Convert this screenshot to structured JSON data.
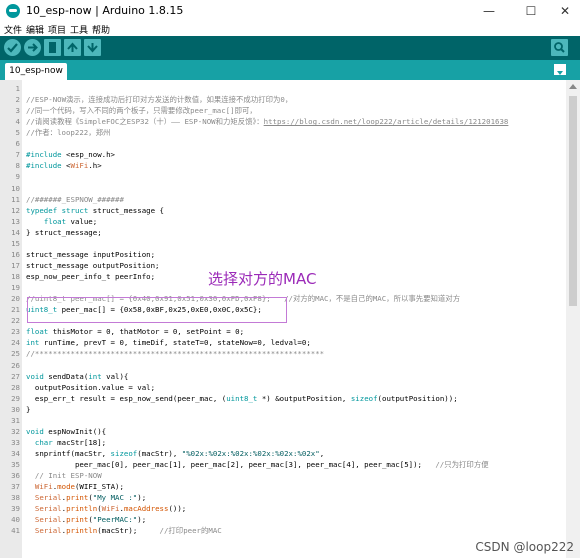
{
  "window": {
    "title": "10_esp-now | Arduino 1.8.15",
    "controls": [
      "—",
      "☐",
      "✕"
    ]
  },
  "menu": [
    "文件",
    "编辑",
    "项目",
    "工具",
    "帮助"
  ],
  "toolbar_icons": [
    "verify-icon",
    "upload-icon",
    "new-icon",
    "open-icon",
    "save-icon",
    "serial-monitor-icon"
  ],
  "tab": {
    "label": "10_esp-now"
  },
  "annotation": {
    "label": "选择对方的MAC"
  },
  "watermark": "CSDN @loop222",
  "code_lines": [
    {
      "n": "1",
      "html": ""
    },
    {
      "n": "2",
      "html": "<span class=\"cmt\">//ESP-NOW演示，连接成功后打印对方发送的计数值，如果连接不成功打印为0，</span>"
    },
    {
      "n": "3",
      "html": "<span class=\"cmt\">//同一个代码，写入不同的两个板子，只需要修改peer_mac[]即可，</span>"
    },
    {
      "n": "4",
      "html": "<span class=\"cmt\">//请阅读教程《SimpleFOC之ESP32（十）—— ESP-NOW和力矩反馈》：<u>https://blog.csdn.net/loop222/article/details/121201638</u></span>"
    },
    {
      "n": "5",
      "html": "<span class=\"cmt\">//作者：loop222，郑州</span>"
    },
    {
      "n": "6",
      "html": ""
    },
    {
      "n": "7",
      "html": "<span class=\"kw\">#include</span> &lt;esp_now.h&gt;"
    },
    {
      "n": "8",
      "html": "<span class=\"kw\">#include</span> &lt;<span class=\"type\">WiFi</span>.h&gt;"
    },
    {
      "n": "9",
      "html": ""
    },
    {
      "n": "10",
      "html": ""
    },
    {
      "n": "11",
      "html": "<span class=\"cmt\">//######_ESPNOW_######</span>"
    },
    {
      "n": "12",
      "html": "<span class=\"kw\">typedef</span> <span class=\"kw\">struct</span> struct_message {"
    },
    {
      "n": "13",
      "html": "    <span class=\"kw\">float</span> value;"
    },
    {
      "n": "14",
      "html": "} struct_message;"
    },
    {
      "n": "15",
      "html": ""
    },
    {
      "n": "16",
      "html": "struct_message inputPosition;"
    },
    {
      "n": "17",
      "html": "struct_message outputPosition;"
    },
    {
      "n": "18",
      "html": "esp_now_peer_info_t peerInfo;"
    },
    {
      "n": "19",
      "html": ""
    },
    {
      "n": "20",
      "html": "<span class=\"cmt\">//uint8_t peer_mac[] = {0x40,0x91,0x51,0x30,0xFD,0xF8};   //对方的MAC，不是自己的MAC，所以事先要知道对方</span>"
    },
    {
      "n": "21",
      "html": "<span class=\"kw\">uint8_t</span> peer_mac[] = {0x58,0xBF,0x25,0xE0,0x0C,0x5C};"
    },
    {
      "n": "22",
      "html": ""
    },
    {
      "n": "23",
      "html": "<span class=\"kw\">float</span> thisMotor = 0, thatMotor = 0, setPoint = 0;"
    },
    {
      "n": "24",
      "html": "<span class=\"kw\">int</span> runTime, prevT = 0, timeDif, stateT=0, stateNow=0, ledval=0;"
    },
    {
      "n": "25",
      "html": "<span class=\"cmt\">//*****************************************************************</span>"
    },
    {
      "n": "26",
      "html": ""
    },
    {
      "n": "27",
      "html": "<span class=\"kw\">void</span> sendData(<span class=\"kw\">int</span> val){"
    },
    {
      "n": "28",
      "html": "  outputPosition.value = val;"
    },
    {
      "n": "29",
      "html": "  esp_err_t result = esp_now_send(peer_mac, (<span class=\"kw\">uint8_t</span> *) &amp;outputPosition, <span class=\"kw\">sizeof</span>(outputPosition));"
    },
    {
      "n": "30",
      "html": "}"
    },
    {
      "n": "31",
      "html": ""
    },
    {
      "n": "32",
      "html": "<span class=\"kw\">void</span> espNowInit(){"
    },
    {
      "n": "33",
      "html": "  <span class=\"kw\">char</span> macStr[18];"
    },
    {
      "n": "34",
      "html": "  snprintf(macStr, <span class=\"kw\">sizeof</span>(macStr), <span class=\"str\">\"%02x:%02x:%02x:%02x:%02x:%02x\"</span>,"
    },
    {
      "n": "35",
      "html": "           peer_mac[0], peer_mac[1], peer_mac[2], peer_mac[3], peer_mac[4], peer_mac[5]);   <span class=\"cmt\">//只为打印方便</span>"
    },
    {
      "n": "36",
      "html": "  <span class=\"cmt\">// Init ESP-NOW</span>"
    },
    {
      "n": "37",
      "html": "  <span class=\"type\">WiFi</span>.<span class=\"fn\">mode</span>(WIFI_STA);"
    },
    {
      "n": "38",
      "html": "  <span class=\"type\">Serial</span>.<span class=\"fn\">print</span>(<span class=\"str\">\"My MAC :\"</span>);"
    },
    {
      "n": "39",
      "html": "  <span class=\"type\">Serial</span>.<span class=\"fn\">println</span>(<span class=\"type\">WiFi</span>.<span class=\"fn\">macAddress</span>());"
    },
    {
      "n": "40",
      "html": "  <span class=\"type\">Serial</span>.<span class=\"fn\">print</span>(<span class=\"str\">\"PeerMAC:\"</span>);"
    },
    {
      "n": "41",
      "html": "  <span class=\"type\">Serial</span>.<span class=\"fn\">println</span>(macStr);     <span class=\"cmt\">//打印peer的MAC</span>"
    }
  ]
}
